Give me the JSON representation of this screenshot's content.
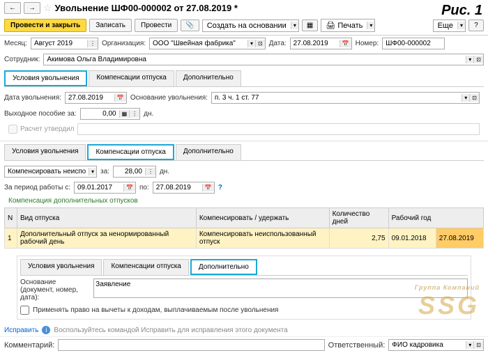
{
  "ris": "Рис. 1",
  "header": {
    "back": "←",
    "fwd": "→",
    "title": "Увольнение ШФ00-000002 от 27.08.2019 *"
  },
  "toolbar": {
    "provesti_zakryt": "Провести и закрыть",
    "zapisat": "Записать",
    "provesti": "Провести",
    "sozdat": "Создать на основании",
    "pechat": "Печать",
    "eshche": "Еще",
    "help": "?"
  },
  "fields": {
    "month_lbl": "Месяц:",
    "month_val": "Август 2019",
    "org_lbl": "Организация:",
    "org_val": "ООО \"Швейная фабрика\"",
    "date_lbl": "Дата:",
    "date_val": "27.08.2019",
    "num_lbl": "Номер:",
    "num_val": "ШФ00-000002",
    "emp_lbl": "Сотрудник:",
    "emp_val": "Акимова Ольга Владимировна"
  },
  "tabs": {
    "t1": "Условия увольнения",
    "t2": "Компенсации отпуска",
    "t3": "Дополнительно"
  },
  "dismiss": {
    "date_lbl": "Дата увольнения:",
    "date_val": "27.08.2019",
    "osn_lbl": "Основание увольнения:",
    "osn_val": "п. 3 ч. 1 ст. 77",
    "vyh_lbl": "Выходное пособие за:",
    "vyh_val": "0,00",
    "dn": "дн.",
    "raschet": "Расчет утвердил"
  },
  "comp": {
    "mode": "Компенсировать неиспол",
    "za": "за:",
    "days": "28,00",
    "dn": "дн.",
    "period_lbl": "За период работы с:",
    "from": "09.01.2017",
    "po": "по:",
    "to": "27.08.2019",
    "section_title": "Компенсация дополнительных отпусков"
  },
  "table": {
    "h1": "N",
    "h2": "Вид отпуска",
    "h3": "Компенсировать / удержать",
    "h4": "Количество дней",
    "h5": "Рабочий год",
    "r1": {
      "n": "1",
      "vid": "Дополнительный отпуск за ненормированный рабочий день",
      "komp": "Компенсировать неиспользованный отпуск",
      "days": "2,75",
      "y1": "09.01.2018",
      "y2": "27.08.2019"
    }
  },
  "dop": {
    "osn_lbl": "Основание (документ, номер, дата):",
    "osn_val": "Заявление",
    "chk": "Применять право на вычеты к доходам, выплачиваемым после увольнения"
  },
  "footer": {
    "ispravit": "Исправить",
    "hint": "Воспользуйтесь командой Исправить для исправления этого документа",
    "komm_lbl": "Комментарий:",
    "otv_lbl": "Ответственный:",
    "otv_val": "ФИО кадровика"
  },
  "watermark": {
    "main": "SSG",
    "sub": "Группа Компаний"
  }
}
